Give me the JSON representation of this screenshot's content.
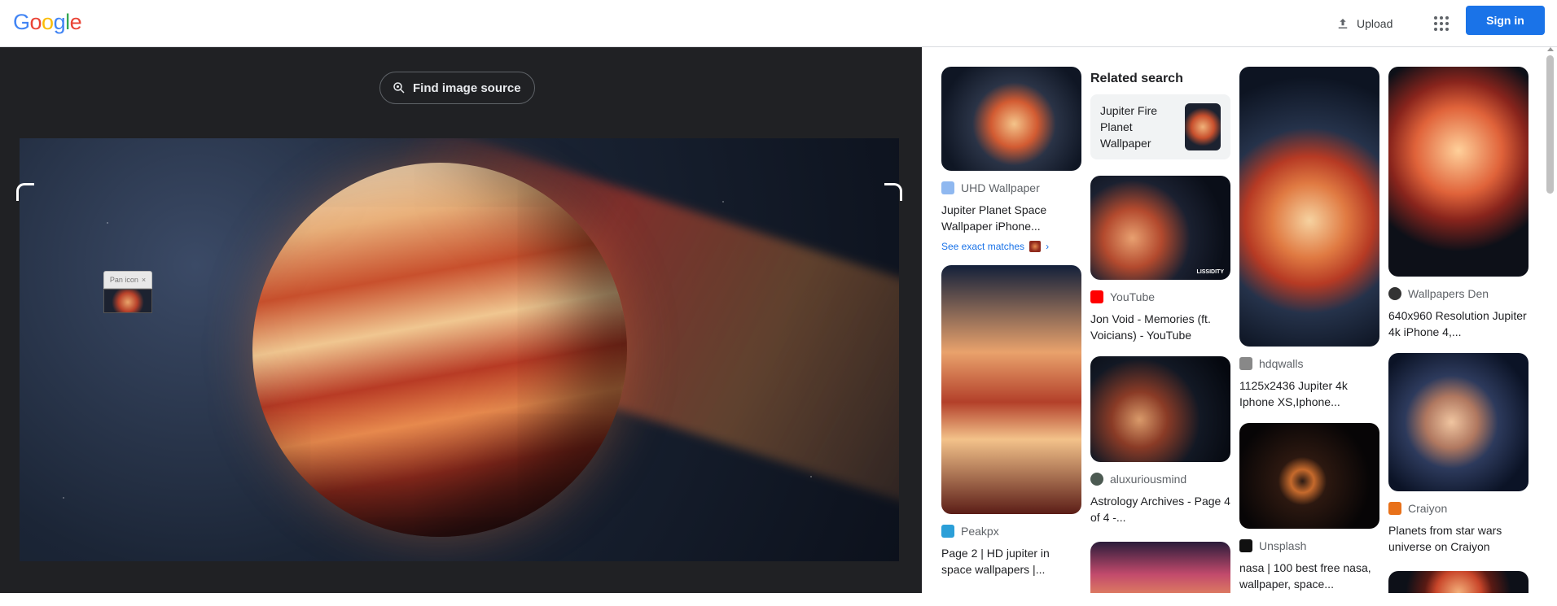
{
  "header": {
    "logo_letters": [
      "G",
      "o",
      "o",
      "g",
      "l",
      "e"
    ],
    "logo_colors": [
      "#4285F4",
      "#EA4335",
      "#FBBC05",
      "#4285F4",
      "#34A853",
      "#EA4335"
    ],
    "upload_label": "Upload",
    "signin_label": "Sign in"
  },
  "viewer": {
    "find_source_label": "Find image source",
    "pin_label": "Pan icon",
    "pin_close": "×"
  },
  "results": {
    "related_heading": "Related search",
    "related_query": "Jupiter Fire Planet Wallpaper",
    "exact_matches_label": "See exact matches",
    "col1": [
      {
        "source": "UHD Wallpaper",
        "title": "Jupiter Planet Space Wallpaper iPhone...",
        "fav": "#8fb8f0"
      },
      {
        "source": "Peakpx",
        "title": "Page 2 | HD jupiter in space wallpapers |...",
        "fav": "#2b9fd8"
      }
    ],
    "col2": [
      {
        "source": "YouTube",
        "title": "Jon Void - Memories (ft. Voicians) - YouTube",
        "fav": "#ff0000"
      },
      {
        "source": "aluxuriousmind",
        "title": "Astrology Archives - Page 4 of 4 -...",
        "fav": "#4c5a52"
      }
    ],
    "col3": [
      {
        "source": "hdqwalls",
        "title": "1125x2436 Jupiter 4k Iphone XS,Iphone...",
        "fav": "#888"
      },
      {
        "source": "Unsplash",
        "title": "nasa | 100 best free nasa, wallpaper, space...",
        "fav": "#111"
      }
    ],
    "col4": [
      {
        "source": "Wallpapers Den",
        "title": "640x960 Resolution Jupiter 4k iPhone 4,...",
        "fav": "#333"
      },
      {
        "source": "Craiyon",
        "title": "Planets from star wars universe on Craiyon",
        "fav": "#e8711a"
      }
    ],
    "watermark_text": "LISSIDITY"
  },
  "colors": {
    "accent": "#1a73e8",
    "viewer_bg": "#202124"
  }
}
